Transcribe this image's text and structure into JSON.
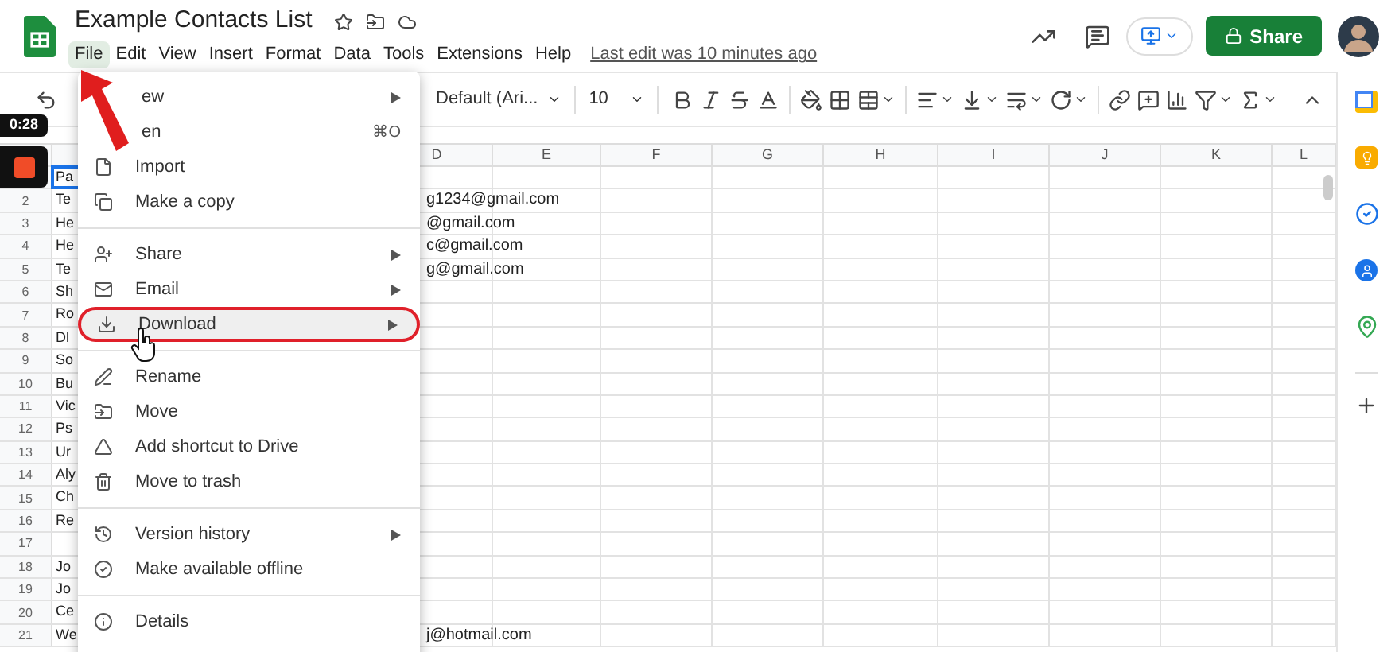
{
  "document": {
    "title": "Example Contacts List",
    "menus": [
      {
        "label": "File",
        "selected": true
      },
      {
        "label": "Edit",
        "selected": false
      },
      {
        "label": "View",
        "selected": false
      },
      {
        "label": "Insert",
        "selected": false
      },
      {
        "label": "Format",
        "selected": false
      },
      {
        "label": "Data",
        "selected": false
      },
      {
        "label": "Tools",
        "selected": false
      },
      {
        "label": "Extensions",
        "selected": false
      },
      {
        "label": "Help",
        "selected": false
      }
    ],
    "last_edit": "Last edit was 10 minutes ago"
  },
  "share_button": {
    "label": "Share"
  },
  "video_overlay": {
    "timestamp": "0:28"
  },
  "toolbar": {
    "font": "Default (Ari...",
    "font_size": "10"
  },
  "file_menu": {
    "items": [
      {
        "kind": "item",
        "label": "ew",
        "submenu": true,
        "highlighted": false
      },
      {
        "kind": "item",
        "label": "en",
        "shortcut": "⌘O",
        "submenu": false,
        "highlighted": false
      },
      {
        "kind": "item",
        "label": "Import",
        "submenu": false,
        "highlighted": false
      },
      {
        "kind": "item",
        "label": "Make a copy",
        "submenu": false,
        "highlighted": false
      },
      {
        "kind": "separator"
      },
      {
        "kind": "item",
        "label": "Share",
        "submenu": true,
        "highlighted": false
      },
      {
        "kind": "item",
        "label": "Email",
        "submenu": true,
        "highlighted": false
      },
      {
        "kind": "item",
        "label": "Download",
        "submenu": true,
        "highlighted": true
      },
      {
        "kind": "separator"
      },
      {
        "kind": "item",
        "label": "Rename",
        "submenu": false,
        "highlighted": false
      },
      {
        "kind": "item",
        "label": "Move",
        "submenu": false,
        "highlighted": false
      },
      {
        "kind": "item",
        "label": "Add shortcut to Drive",
        "submenu": false,
        "highlighted": false
      },
      {
        "kind": "item",
        "label": "Move to trash",
        "submenu": false,
        "highlighted": false
      },
      {
        "kind": "separator"
      },
      {
        "kind": "item",
        "label": "Version history",
        "submenu": true,
        "highlighted": false
      },
      {
        "kind": "item",
        "label": "Make available offline",
        "submenu": false,
        "highlighted": false
      },
      {
        "kind": "separator"
      },
      {
        "kind": "item",
        "label": "Details",
        "submenu": false,
        "highlighted": false
      }
    ]
  },
  "sheet": {
    "columns": [
      "D",
      "E",
      "F",
      "G",
      "H",
      "I",
      "J",
      "K",
      "L"
    ],
    "rows": [
      {
        "a": "Pa",
        "selected": true
      },
      {
        "number": "2",
        "a": "Te",
        "d": "g1234@gmail.com",
        "selected": false
      },
      {
        "number": "3",
        "a": "He",
        "d": "@gmail.com",
        "selected": false
      },
      {
        "number": "4",
        "a": "He",
        "d": "c@gmail.com",
        "selected": false
      },
      {
        "number": "5",
        "a": "Te",
        "d": "g@gmail.com",
        "selected": false
      },
      {
        "number": "6",
        "a": "Sh",
        "selected": false
      },
      {
        "number": "7",
        "a": "Ro",
        "selected": false
      },
      {
        "number": "8",
        "a": "Dl",
        "selected": false
      },
      {
        "number": "9",
        "a": "So",
        "selected": false
      },
      {
        "number": "10",
        "a": "Bu",
        "selected": false
      },
      {
        "number": "11",
        "a": "Vic",
        "selected": false
      },
      {
        "number": "12",
        "a": "Ps",
        "selected": false
      },
      {
        "number": "13",
        "a": "Ur",
        "selected": false
      },
      {
        "number": "14",
        "a": "Aly",
        "selected": false
      },
      {
        "number": "15",
        "a": "Ch",
        "selected": false
      },
      {
        "number": "16",
        "a": "Re",
        "selected": false
      },
      {
        "number": "17",
        "selected": false
      },
      {
        "number": "18",
        "a": "Jo",
        "selected": false
      },
      {
        "number": "19",
        "a": "Jo",
        "selected": false
      },
      {
        "number": "20",
        "a": "Ce",
        "selected": false
      },
      {
        "number": "21",
        "a": "We",
        "d": "j@hotmail.com",
        "selected": false
      }
    ]
  }
}
